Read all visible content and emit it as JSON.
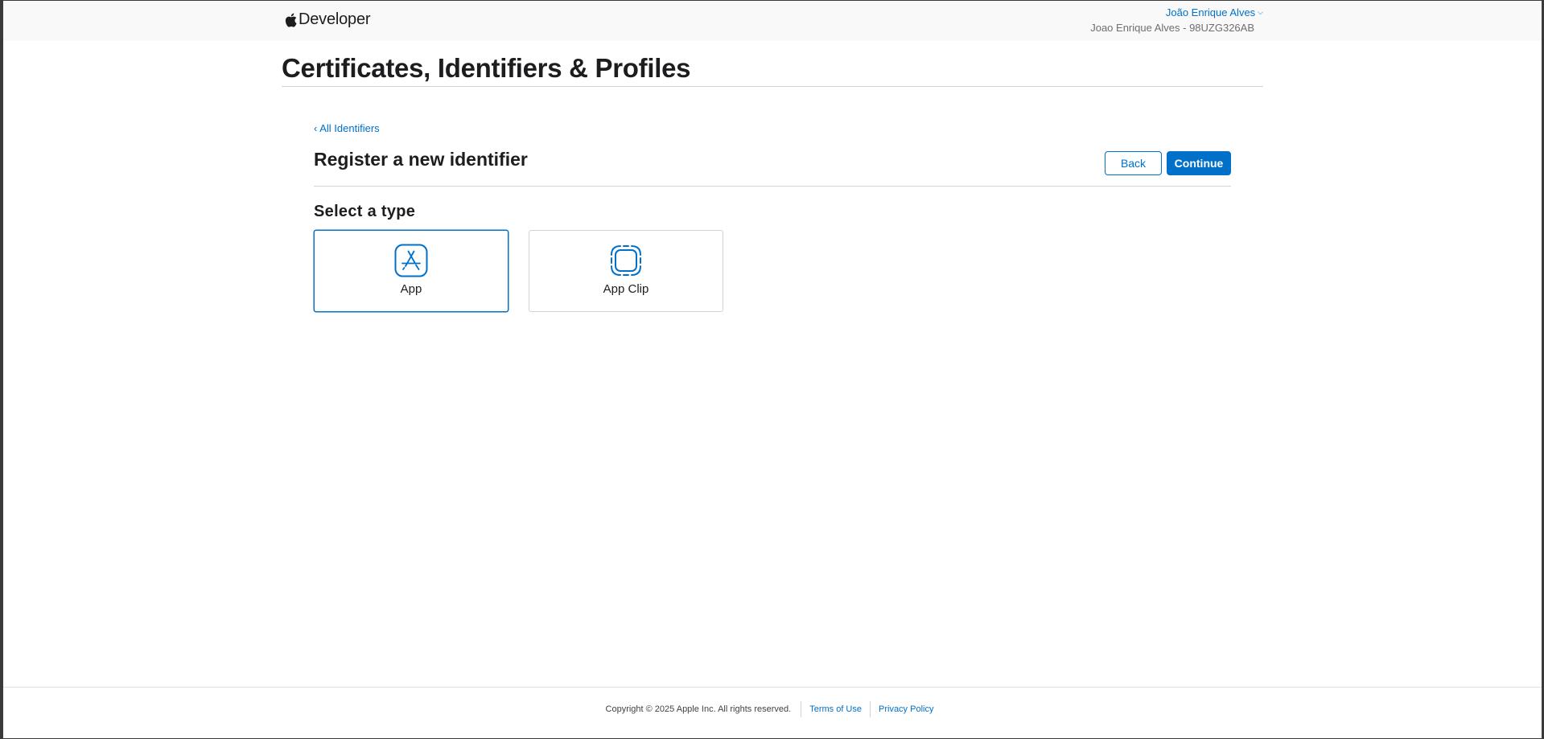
{
  "header": {
    "brand": "Developer",
    "account_name": "João Enrique Alves",
    "account_team": "Joao Enrique Alves - 98UZG326AB"
  },
  "page": {
    "title": "Certificates, Identifiers & Profiles",
    "back_link": "‹ All Identifiers",
    "heading": "Register a new identifier",
    "back_button": "Back",
    "continue_button": "Continue",
    "select_label": "Select a type"
  },
  "types": [
    {
      "label": "App",
      "icon": "app-store-icon",
      "selected": true
    },
    {
      "label": "App Clip",
      "icon": "app-clip-icon",
      "selected": false
    }
  ],
  "footer": {
    "copyright": "Copyright © 2025 Apple Inc. All rights reserved.",
    "terms": "Terms of Use",
    "privacy": "Privacy Policy"
  },
  "colors": {
    "accent": "#0070c9",
    "text": "#1d1d1f",
    "divider": "#d2d2d7",
    "header_bg": "#f9f9f9"
  }
}
